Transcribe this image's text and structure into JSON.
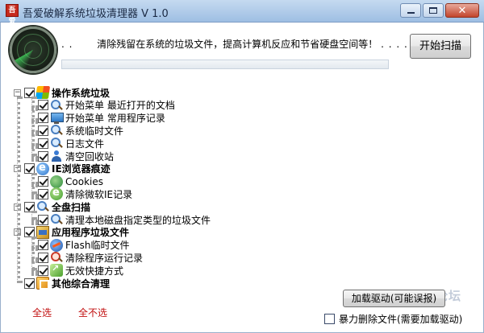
{
  "window": {
    "title": "吾爱破解系统垃圾清理器 V 1.0",
    "icon_label": "吾爱"
  },
  "header": {
    "dots": ". .",
    "description": "清除残留在系统的垃圾文件，提高计算机反应和节省硬盘空间等！",
    "trailing_dots": ". . . . . . . .",
    "progress_fraction": 0.0,
    "scan_button": "开始扫描"
  },
  "tree": {
    "groups": [
      {
        "label": "操作系统垃圾",
        "checked": true,
        "icon": "windows-logo-icon",
        "items": [
          {
            "label": "开始菜单 最近打开的文档",
            "checked": true,
            "icon": "search-icon"
          },
          {
            "label": "开始菜单 常用程序记录",
            "checked": true,
            "icon": "monitor-icon"
          },
          {
            "label": "系统临时文件",
            "checked": true,
            "icon": "search-icon"
          },
          {
            "label": "日志文件",
            "checked": true,
            "icon": "search-icon"
          },
          {
            "label": "清空回收站",
            "checked": true,
            "icon": "user-icon"
          }
        ]
      },
      {
        "label": "IE浏览器痕迹",
        "checked": true,
        "icon": "ie-icon",
        "items": [
          {
            "label": "Cookies",
            "checked": true,
            "icon": "cookie-icon"
          },
          {
            "label": "清除微软IE记录",
            "checked": true,
            "icon": "ie-green-icon"
          }
        ]
      },
      {
        "label": "全盘扫描",
        "checked": true,
        "icon": "search-icon",
        "items": [
          {
            "label": "清理本地磁盘指定类型的垃圾文件",
            "checked": true,
            "icon": "search-icon"
          }
        ]
      },
      {
        "label": "应用程序垃圾文件",
        "checked": true,
        "icon": "package-icon",
        "items": [
          {
            "label": "Flash临时文件",
            "checked": true,
            "icon": "flash-icon"
          },
          {
            "label": "清除程序运行记录",
            "checked": true,
            "icon": "magnifier-red-icon"
          },
          {
            "label": "无效快捷方式",
            "checked": true,
            "icon": "shortcut-icon"
          }
        ]
      },
      {
        "label": "其他综合清理",
        "checked": true,
        "icon": "misc-icon",
        "items": []
      }
    ]
  },
  "footer": {
    "select_all": "全选",
    "select_none": "全不选",
    "driver_button": "加载驱动(可能误报)",
    "force_delete_label": "暴力删除文件(需要加载驱动)",
    "force_delete_checked": false,
    "watermark": "吾爱破解论坛"
  },
  "colors": {
    "link_red": "#c21010",
    "titlebar": "#c5daf0"
  }
}
